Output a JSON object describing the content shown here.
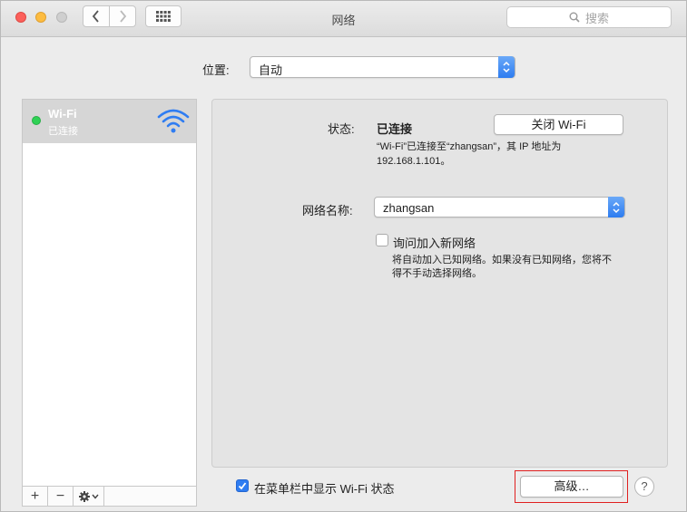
{
  "window": {
    "title": "网络"
  },
  "search": {
    "placeholder": "搜索"
  },
  "location": {
    "label": "位置:",
    "value": "自动"
  },
  "sidebar": {
    "items": [
      {
        "name": "Wi-Fi",
        "status": "已连接"
      }
    ],
    "add_label": "+",
    "remove_label": "−"
  },
  "detail": {
    "status_label": "状态:",
    "status_value": "已连接",
    "toggle_button": "关闭 Wi-Fi",
    "status_desc_1": "“Wi-Fi”已连接至“zhangsan”，其 IP 地址为",
    "status_desc_2": "192.168.1.101。",
    "network_name_label": "网络名称:",
    "network_name_value": "zhangsan",
    "ask_join_label": "询问加入新网络",
    "ask_join_desc_1": "将自动加入已知网络。如果没有已知网络，您将不",
    "ask_join_desc_2": "得不手动选择网络。"
  },
  "footer": {
    "show_in_menubar_label": "在菜单栏中显示 Wi-Fi 状态",
    "advanced_button": "高级…",
    "help_label": "?"
  },
  "colors": {
    "accent": "#2f7df2",
    "connected": "#2fd155"
  }
}
